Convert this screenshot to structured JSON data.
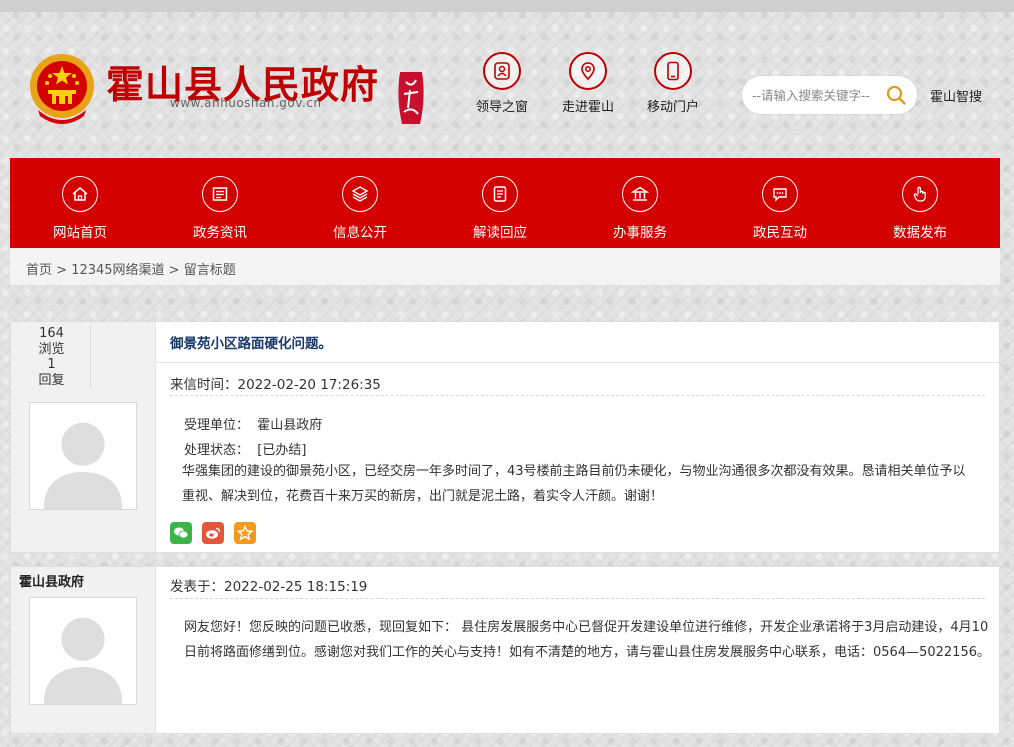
{
  "header": {
    "site_title": "霍山县人民政府",
    "site_url": "www.ahhuoshan.gov.cn",
    "quick_links": [
      {
        "label": "领导之窗",
        "icon": "leader-icon"
      },
      {
        "label": "走进霍山",
        "icon": "location-pin-icon"
      },
      {
        "label": "移动门户",
        "icon": "mobile-phone-icon"
      }
    ],
    "search_placeholder": "--请输入搜索关键字--",
    "zhisou_label": "霍山智搜"
  },
  "nav": [
    {
      "label": "网站首页",
      "icon": "home-icon"
    },
    {
      "label": "政务资讯",
      "icon": "news-icon"
    },
    {
      "label": "信息公开",
      "icon": "layers-icon"
    },
    {
      "label": "解读回应",
      "icon": "document-icon"
    },
    {
      "label": "办事服务",
      "icon": "bank-icon"
    },
    {
      "label": "政民互动",
      "icon": "chat-icon"
    },
    {
      "label": "数据发布",
      "icon": "hand-pointer-icon"
    }
  ],
  "breadcrumb": {
    "home": "首页",
    "sep1": " > ",
    "channel": "12345网络渠道",
    "sep2": " > ",
    "current": "留言标题"
  },
  "message": {
    "views_count": "164",
    "views_label": "浏览",
    "replies_count": "1",
    "replies_label": "回复",
    "subject": "御景苑小区路面硬化问题。",
    "time_label": "来信时间：",
    "time": "2022-02-20 17:26:35",
    "unit_label": "受理单位：",
    "unit": "霍山县政府",
    "status_label": "处理状态：",
    "status": "[已办结]",
    "content_line1": "华强集团的建设的御景苑小区，已经交房一年多时间了，43号楼前主路目前仍未硬化，与物业沟通很多次都没有效果。恳请相关单位予以",
    "content_line2": "重视、解决到位，花费百十来万买的新房，出门就是泥土路，着实令人汗颜。谢谢！"
  },
  "share": [
    {
      "icon": "wechat-icon",
      "color": "#3bb54a"
    },
    {
      "icon": "weibo-icon",
      "color": "#e6553a"
    },
    {
      "icon": "star-icon",
      "color": "#f39a1e"
    }
  ],
  "reply": {
    "org": "霍山县政府",
    "time_label": "发表于：",
    "time": "2022-02-25 18:15:19",
    "content_line1": "网友您好！您反映的问题已收悉，现回复如下： 县住房发展服务中心已督促开发建设单位进行维修，开发企业承诺将于3月启动建设，4月10",
    "content_line2": "日前将路面修缮到位。感谢您对我们工作的关心与支持！如有不清楚的地方，请与霍山县住房发展服务中心联系，电话：0564—5022156。"
  },
  "colors": {
    "brand_red": "#d40000",
    "title_red": "#c00000",
    "subject_blue": "#1a3a6a"
  }
}
